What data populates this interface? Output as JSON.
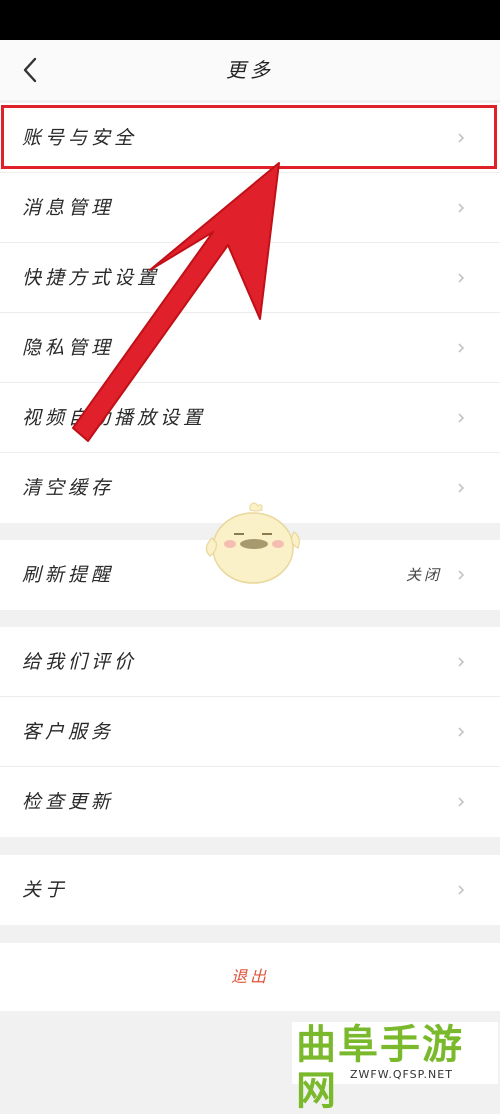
{
  "header": {
    "title": "更多",
    "back_icon": "chevron-left-icon"
  },
  "groups": [
    {
      "items": [
        {
          "label": "账号与安全"
        },
        {
          "label": "消息管理"
        },
        {
          "label": "快捷方式设置"
        },
        {
          "label": "隐私管理"
        },
        {
          "label": "视频自动播放设置"
        },
        {
          "label": "清空缓存"
        }
      ]
    },
    {
      "items": [
        {
          "label": "刷新提醒",
          "value": "关闭"
        }
      ]
    },
    {
      "items": [
        {
          "label": "给我们评价"
        },
        {
          "label": "客户服务"
        },
        {
          "label": "检查更新"
        }
      ]
    },
    {
      "items": [
        {
          "label": "关于"
        }
      ]
    }
  ],
  "logout": {
    "label": "退出"
  },
  "annotation": {
    "color": "#e0202a"
  },
  "watermark": {
    "title": "曲阜手游网",
    "url": "ZWFW.QFSP.NET"
  },
  "colors": {
    "accent": "#e0553b",
    "background": "#f1f1f1"
  }
}
